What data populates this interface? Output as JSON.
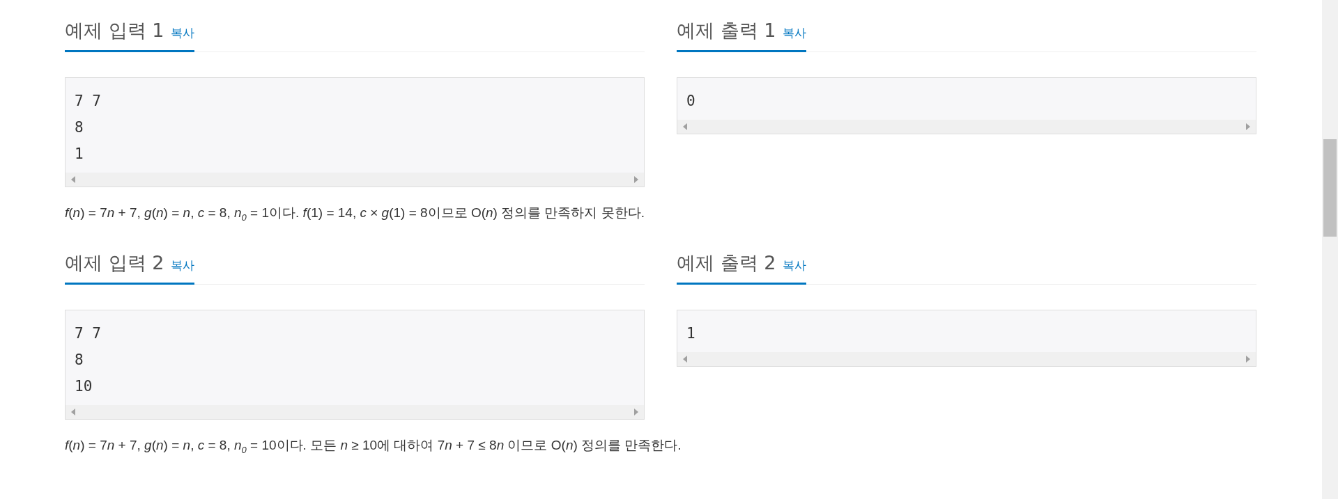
{
  "samples": [
    {
      "input": {
        "title": "예제 입력 1",
        "copy": "복사",
        "text": "7 7\n8\n1"
      },
      "output": {
        "title": "예제 출력 1",
        "copy": "복사",
        "text": "0"
      },
      "explanation": [
        {
          "text": "f",
          "kind": "italic"
        },
        {
          "text": "(",
          "kind": "plain"
        },
        {
          "text": "n",
          "kind": "italic"
        },
        {
          "text": ") = 7",
          "kind": "plain"
        },
        {
          "text": "n",
          "kind": "italic"
        },
        {
          "text": " + 7, ",
          "kind": "plain"
        },
        {
          "text": "g",
          "kind": "italic"
        },
        {
          "text": "(",
          "kind": "plain"
        },
        {
          "text": "n",
          "kind": "italic"
        },
        {
          "text": ") = ",
          "kind": "plain"
        },
        {
          "text": "n",
          "kind": "italic"
        },
        {
          "text": ", ",
          "kind": "plain"
        },
        {
          "text": "c",
          "kind": "italic"
        },
        {
          "text": " = 8, ",
          "kind": "plain"
        },
        {
          "text": "n",
          "kind": "italic"
        },
        {
          "text": "0",
          "kind": "sub"
        },
        {
          "text": " = 1이다. ",
          "kind": "plain"
        },
        {
          "text": "f",
          "kind": "italic"
        },
        {
          "text": "(1) = 14, ",
          "kind": "plain"
        },
        {
          "text": "c",
          "kind": "italic"
        },
        {
          "text": " × ",
          "kind": "plain"
        },
        {
          "text": "g",
          "kind": "italic"
        },
        {
          "text": "(1) = 8이므로 O(",
          "kind": "plain"
        },
        {
          "text": "n",
          "kind": "italic"
        },
        {
          "text": ") 정의를 만족하지 못한다.",
          "kind": "plain"
        }
      ]
    },
    {
      "input": {
        "title": "예제 입력 2",
        "copy": "복사",
        "text": "7 7\n8\n10"
      },
      "output": {
        "title": "예제 출력 2",
        "copy": "복사",
        "text": "1"
      },
      "explanation": [
        {
          "text": "f",
          "kind": "italic"
        },
        {
          "text": "(",
          "kind": "plain"
        },
        {
          "text": "n",
          "kind": "italic"
        },
        {
          "text": ") = 7",
          "kind": "plain"
        },
        {
          "text": "n",
          "kind": "italic"
        },
        {
          "text": " + 7, ",
          "kind": "plain"
        },
        {
          "text": "g",
          "kind": "italic"
        },
        {
          "text": "(",
          "kind": "plain"
        },
        {
          "text": "n",
          "kind": "italic"
        },
        {
          "text": ") = ",
          "kind": "plain"
        },
        {
          "text": "n",
          "kind": "italic"
        },
        {
          "text": ", ",
          "kind": "plain"
        },
        {
          "text": "c",
          "kind": "italic"
        },
        {
          "text": " = 8, ",
          "kind": "plain"
        },
        {
          "text": "n",
          "kind": "italic"
        },
        {
          "text": "0",
          "kind": "sub"
        },
        {
          "text": " = 10이다. 모든 ",
          "kind": "plain"
        },
        {
          "text": "n",
          "kind": "italic"
        },
        {
          "text": " ≥ 10에 대하여 7",
          "kind": "plain"
        },
        {
          "text": "n",
          "kind": "italic"
        },
        {
          "text": " + 7 ≤ 8",
          "kind": "plain"
        },
        {
          "text": "n",
          "kind": "italic"
        },
        {
          "text": " 이므로 O(",
          "kind": "plain"
        },
        {
          "text": "n",
          "kind": "italic"
        },
        {
          "text": ") 정의를 만족한다.",
          "kind": "plain"
        }
      ]
    }
  ]
}
